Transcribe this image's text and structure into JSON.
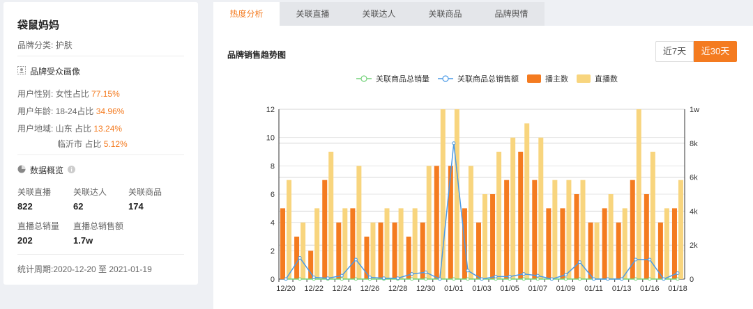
{
  "brand": {
    "name": "袋鼠妈妈",
    "category_label": "品牌分类:",
    "category_value": "护肤"
  },
  "audience": {
    "title": "品牌受众画像",
    "gender_label": "用户性别:",
    "gender_text": "女性占比",
    "gender_pct": "77.15%",
    "age_label": "用户年龄:",
    "age_text": "18-24占比",
    "age_pct": "34.96%",
    "region_label": "用户地域:",
    "region1_text": "山东 占比",
    "region1_pct": "13.24%",
    "region2_text": "临沂市 占比",
    "region2_pct": "5.12%"
  },
  "overview": {
    "title": "数据概览",
    "live_label": "关联直播",
    "live_value": "822",
    "kol_label": "关联达人",
    "kol_value": "62",
    "goods_label": "关联商品",
    "goods_value": "174",
    "sales_label": "直播总销量",
    "sales_value": "202",
    "amount_label": "直播总销售额",
    "amount_value": "1.7w",
    "period": "统计周期:2020-12-20 至 2021-01-19"
  },
  "tabs": [
    {
      "label": "热度分析",
      "active": true
    },
    {
      "label": "关联直播",
      "active": false
    },
    {
      "label": "关联达人",
      "active": false
    },
    {
      "label": "关联商品",
      "active": false
    },
    {
      "label": "品牌舆情",
      "active": false
    }
  ],
  "chart_header": {
    "title": "品牌销售趋势图",
    "range_7": "近7天",
    "range_30": "近30天"
  },
  "colors": {
    "accent": "#f47b20",
    "anchors": "#f47b20",
    "lives": "#f8d57e",
    "sales_line": "#74d27a",
    "amount_line": "#4a9ae6"
  },
  "chart_data": {
    "type": "bar",
    "legend_position": "top-center",
    "grid": true,
    "categories": [
      "12/20",
      "12/21",
      "12/22",
      "12/23",
      "12/24",
      "12/25",
      "12/26",
      "12/27",
      "12/28",
      "12/29",
      "12/30",
      "12/31",
      "01/01",
      "01/02",
      "01/03",
      "01/04",
      "01/05",
      "01/06",
      "01/07",
      "01/08",
      "01/09",
      "01/10",
      "01/11",
      "01/12",
      "01/13",
      "01/14",
      "01/16",
      "01/17",
      "01/18"
    ],
    "x_tick_labels": [
      "12/20",
      "12/22",
      "12/24",
      "12/26",
      "12/28",
      "12/30",
      "01/01",
      "01/03",
      "01/05",
      "01/07",
      "01/09",
      "01/11",
      "01/13",
      "01/16",
      "01/18"
    ],
    "y_left": {
      "min": 0,
      "max": 12,
      "ticks": [
        "0",
        "2",
        "4",
        "6",
        "8",
        "10",
        "12"
      ]
    },
    "y_right": {
      "min": 0,
      "max": 10000,
      "ticks": [
        "0",
        "2k",
        "4k",
        "6k",
        "8k",
        "1w"
      ]
    },
    "series": [
      {
        "name": "关联商品总销量",
        "type": "line",
        "axis": "left",
        "values": [
          0,
          0,
          0,
          0,
          0,
          0,
          0,
          0,
          0,
          0,
          0,
          0,
          0,
          0,
          0,
          0,
          0,
          0,
          0,
          0,
          0,
          0,
          0,
          0,
          0,
          0,
          0,
          0,
          0
        ]
      },
      {
        "name": "关联商品总销售额",
        "type": "line",
        "axis": "right",
        "values": [
          0,
          1250,
          100,
          50,
          200,
          1150,
          100,
          50,
          50,
          300,
          400,
          0,
          8000,
          500,
          0,
          150,
          150,
          300,
          200,
          0,
          250,
          1000,
          0,
          0,
          0,
          1150,
          1150,
          0,
          350
        ]
      },
      {
        "name": "播主数",
        "type": "bar",
        "axis": "left",
        "values": [
          5,
          3,
          2,
          7,
          4,
          5,
          3,
          4,
          4,
          3,
          4,
          8,
          8,
          5,
          4,
          6,
          7,
          9,
          7,
          5,
          5,
          6,
          4,
          5,
          4,
          7,
          6,
          4,
          5
        ]
      },
      {
        "name": "直播数",
        "type": "bar",
        "axis": "left",
        "values": [
          7,
          4,
          5,
          9,
          5,
          8,
          4,
          5,
          5,
          5,
          8,
          12,
          12,
          8,
          6,
          9,
          10,
          11,
          10,
          7,
          7,
          7,
          4,
          6,
          5,
          12,
          9,
          5,
          7
        ]
      }
    ]
  }
}
